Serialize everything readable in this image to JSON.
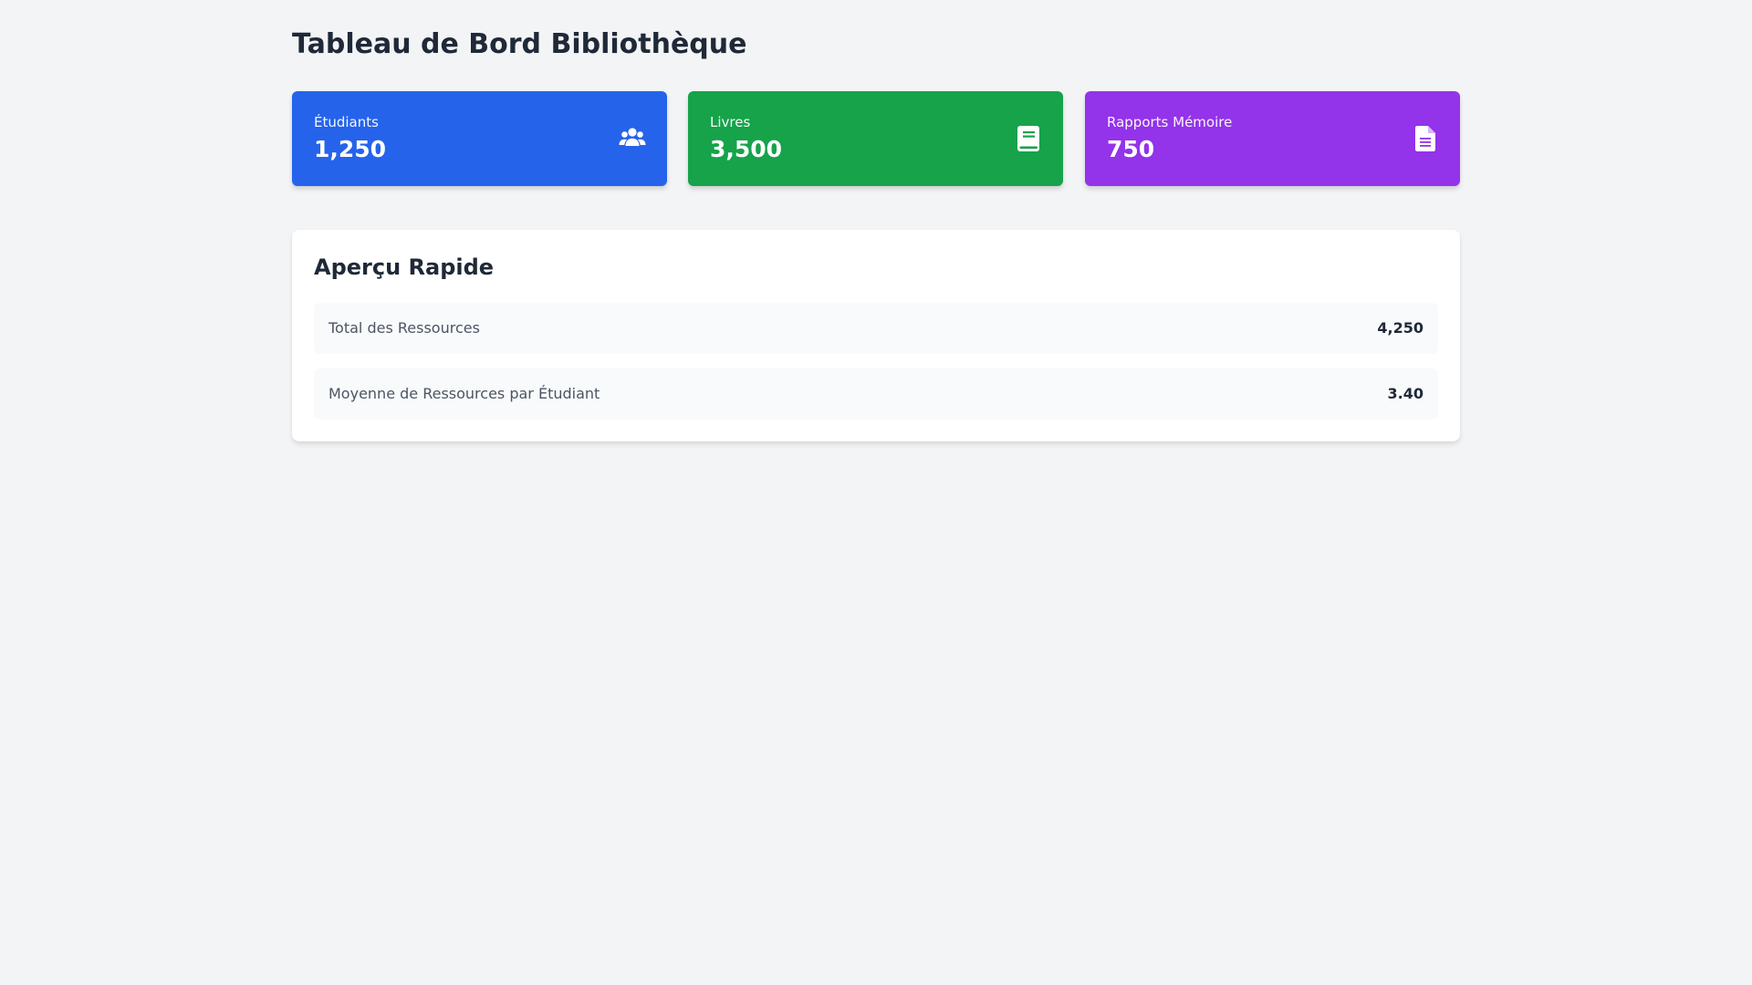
{
  "page": {
    "title": "Tableau de Bord Bibliothèque"
  },
  "cards": [
    {
      "label": "Étudiants",
      "value": "1,250",
      "icon": "users-icon",
      "color": "#2563eb"
    },
    {
      "label": "Livres",
      "value": "3,500",
      "icon": "book-icon",
      "color": "#16a34a"
    },
    {
      "label": "Rapports Mémoire",
      "value": "750",
      "icon": "document-icon",
      "color": "#9333ea"
    }
  ],
  "overview": {
    "title": "Aperçu Rapide",
    "rows": [
      {
        "label": "Total des Ressources",
        "value": "4,250"
      },
      {
        "label": "Moyenne de Ressources par Étudiant",
        "value": "3.40"
      }
    ]
  },
  "colors": {
    "background": "#f3f4f6",
    "panel": "#ffffff",
    "row_background": "#f9fafb",
    "text_primary": "#1f2937",
    "text_secondary": "#4b5563"
  }
}
